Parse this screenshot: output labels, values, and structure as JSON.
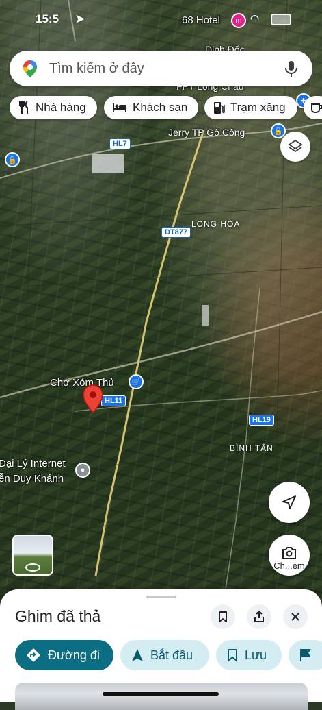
{
  "status_bar": {
    "time": "15:5",
    "hotel_label": "68 Hotel"
  },
  "search": {
    "placeholder": "Tìm kiếm ở đây"
  },
  "chips": [
    {
      "label": "Nhà hàng",
      "icon": "restaurant-icon"
    },
    {
      "label": "Khách sạn",
      "icon": "hotel-icon"
    },
    {
      "label": "Trạm xăng",
      "icon": "gas-station-icon"
    }
  ],
  "map_labels": {
    "top_place_1": "Dinh Đốc...",
    "top_place_2": "FPT Long Châu",
    "jerry": "Jerry TP Gò Công",
    "area_long_hoa": "LONG HÒA",
    "area_binh_tan": "BÌNH TÂN",
    "market": "Chợ Xóm Thủ",
    "internet_line1": "Đại Lý Internet",
    "internet_line2": "ễn Duy Khánh"
  },
  "road_shields": {
    "hl7": "HL7",
    "dt877": "DT877",
    "hl11": "HL11",
    "hl19": "HL19"
  },
  "street_view": {
    "label": "Ch...em"
  },
  "sheet": {
    "title": "Ghim đã thả",
    "actions": {
      "directions": "Đường đi",
      "start": "Bắt đầu",
      "save": "Lưu"
    }
  },
  "colors": {
    "primary": "#0b6e83",
    "secondary_bg": "#d4edf3",
    "pin": "#ea4335",
    "shield_blue": "#1a73e8"
  }
}
